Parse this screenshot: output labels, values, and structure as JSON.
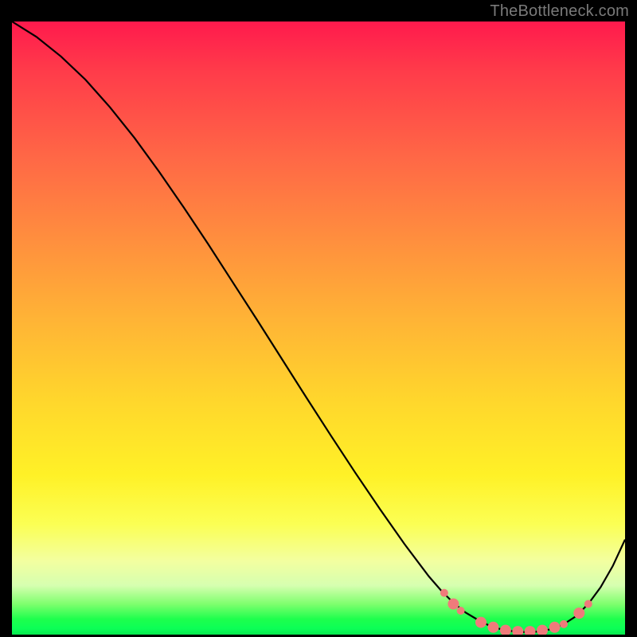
{
  "watermark": "TheBottleneck.com",
  "chart_data": {
    "type": "line",
    "title": "",
    "xlabel": "",
    "ylabel": "",
    "xlim": [
      0,
      100
    ],
    "ylim": [
      0,
      100
    ],
    "grid": false,
    "legend": false,
    "background_gradient": [
      "#ff1a4d",
      "#ff8a3f",
      "#ffd72c",
      "#f3ffa0",
      "#0cff56"
    ],
    "series": [
      {
        "name": "curve",
        "color": "#000000",
        "x": [
          0,
          4,
          8,
          12,
          16,
          20,
          24,
          28,
          32,
          36,
          40,
          44,
          48,
          52,
          56,
          60,
          64,
          68,
          70,
          72,
          74,
          76,
          78,
          80,
          82,
          84,
          86,
          88,
          90,
          92,
          94,
          96,
          98,
          100
        ],
        "values": [
          100,
          97.5,
          94.3,
          90.5,
          86,
          81,
          75.5,
          69.7,
          63.7,
          57.5,
          51.3,
          45,
          38.7,
          32.5,
          26.4,
          20.5,
          14.8,
          9.5,
          7.2,
          5.2,
          3.6,
          2.4,
          1.4,
          0.8,
          0.5,
          0.4,
          0.5,
          0.9,
          1.7,
          3.0,
          5.0,
          7.7,
          11.2,
          15.5
        ]
      }
    ],
    "markers": {
      "name": "highlight-dots",
      "color": "#ef7b7b",
      "radius_small": 5,
      "radius_large": 7,
      "points": [
        {
          "x": 70.5,
          "y": 6.8,
          "r": "small"
        },
        {
          "x": 72.0,
          "y": 5.0,
          "r": "large"
        },
        {
          "x": 73.2,
          "y": 3.9,
          "r": "small"
        },
        {
          "x": 76.5,
          "y": 2.0,
          "r": "large"
        },
        {
          "x": 78.5,
          "y": 1.2,
          "r": "large"
        },
        {
          "x": 80.5,
          "y": 0.7,
          "r": "large"
        },
        {
          "x": 82.5,
          "y": 0.5,
          "r": "large"
        },
        {
          "x": 84.5,
          "y": 0.5,
          "r": "large"
        },
        {
          "x": 86.5,
          "y": 0.7,
          "r": "large"
        },
        {
          "x": 88.5,
          "y": 1.2,
          "r": "large"
        },
        {
          "x": 90.0,
          "y": 1.7,
          "r": "small"
        },
        {
          "x": 92.5,
          "y": 3.5,
          "r": "large"
        },
        {
          "x": 94.0,
          "y": 5.0,
          "r": "small"
        }
      ]
    }
  }
}
